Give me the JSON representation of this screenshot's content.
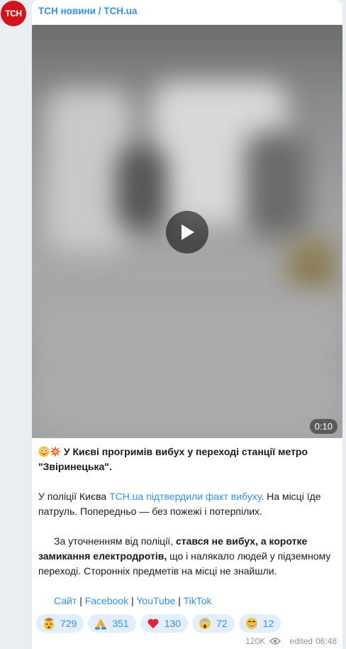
{
  "channel": {
    "avatar_text": "ТСН",
    "name": "ТСН новини / TCH.ua"
  },
  "video": {
    "duration": "0:10"
  },
  "post": {
    "headline": "У Києві прогримів вибух у переході станції метро \"Звіринецька\".",
    "p2_before": "У поліції Києва ",
    "p2_link": "TCH.ua підтвердили факт вибуху",
    "p2_after": ". На місці їде патруль. Попередньо — без пожежі і потерпілих.",
    "p3_before": "За уточненням від поліції, ",
    "p3_bold": "стався не вибух, а коротке замикання електродротів,",
    "p3_after": " що і налякало людей у підземному переході. Сторонніх предметів на місці не знайшли.",
    "links": {
      "site": "Сайт",
      "sep": "|",
      "facebook": "Facebook",
      "youtube": "YouTube",
      "tiktok": "TikTok"
    }
  },
  "reactions": [
    {
      "icon": "exploding-head-emoji",
      "count": "729"
    },
    {
      "icon": "folded-hands-emoji",
      "count": "351"
    },
    {
      "icon": "red-heart-emoji",
      "count": "130"
    },
    {
      "icon": "screaming-face-emoji",
      "count": "72"
    },
    {
      "icon": "grinning-face-emoji",
      "count": "12"
    }
  ],
  "meta": {
    "views": "120K",
    "edited_label": "edited",
    "time": "06:48"
  }
}
